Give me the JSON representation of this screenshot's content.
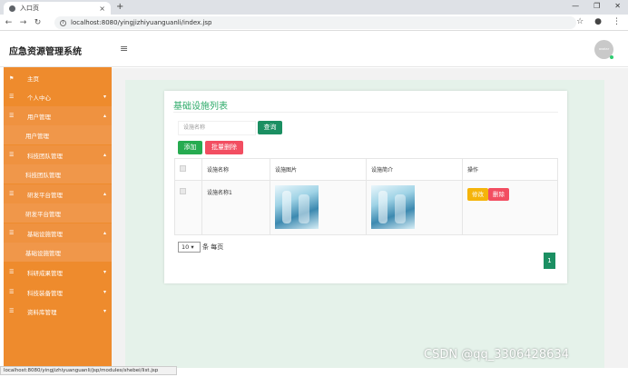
{
  "browser": {
    "tab_title": "入口页",
    "tab_close": "×",
    "new_tab": "+",
    "url": "localhost:8080/yingjizhiyuanguanli/index.jsp",
    "status_url": "localhost:8080/yingjizhiyuanguanli/jsp/modules/shebei/list.jsp"
  },
  "header": {
    "app_name": "应急资源管理系统",
    "avatar_label": "avatar"
  },
  "sidebar": {
    "items": [
      {
        "label": "主页",
        "icon": "flag-icon"
      },
      {
        "label": "个人中心",
        "icon": "list-icon"
      },
      {
        "label": "用户管理",
        "icon": "list-icon"
      },
      {
        "label": "用户管理"
      },
      {
        "label": "科技团队管理",
        "icon": "list-icon"
      },
      {
        "label": "科技团队管理"
      },
      {
        "label": "研发平台管理",
        "icon": "list-icon"
      },
      {
        "label": "研发平台管理"
      },
      {
        "label": "基础设施管理",
        "icon": "list-icon"
      },
      {
        "label": "基础设施管理"
      },
      {
        "label": "科研成果管理",
        "icon": "list-icon"
      },
      {
        "label": "科技装备管理",
        "icon": "list-icon"
      },
      {
        "label": "资料库管理",
        "icon": "list-icon"
      }
    ]
  },
  "main": {
    "title": "基础设施列表",
    "search_placeholder": "设施名称",
    "query_btn": "查询",
    "add_btn": "添加",
    "batch_delete_btn": "批量删除",
    "columns": [
      "设施名称",
      "设施图片",
      "设施简介",
      "操作"
    ],
    "rows": [
      {
        "name": "设施名称1",
        "edit": "修改",
        "delete": "删除"
      }
    ],
    "page_size": "10",
    "page_size_text": "条 每页",
    "current_page": "1"
  },
  "watermark": "CSDN @qq_3306428634"
}
